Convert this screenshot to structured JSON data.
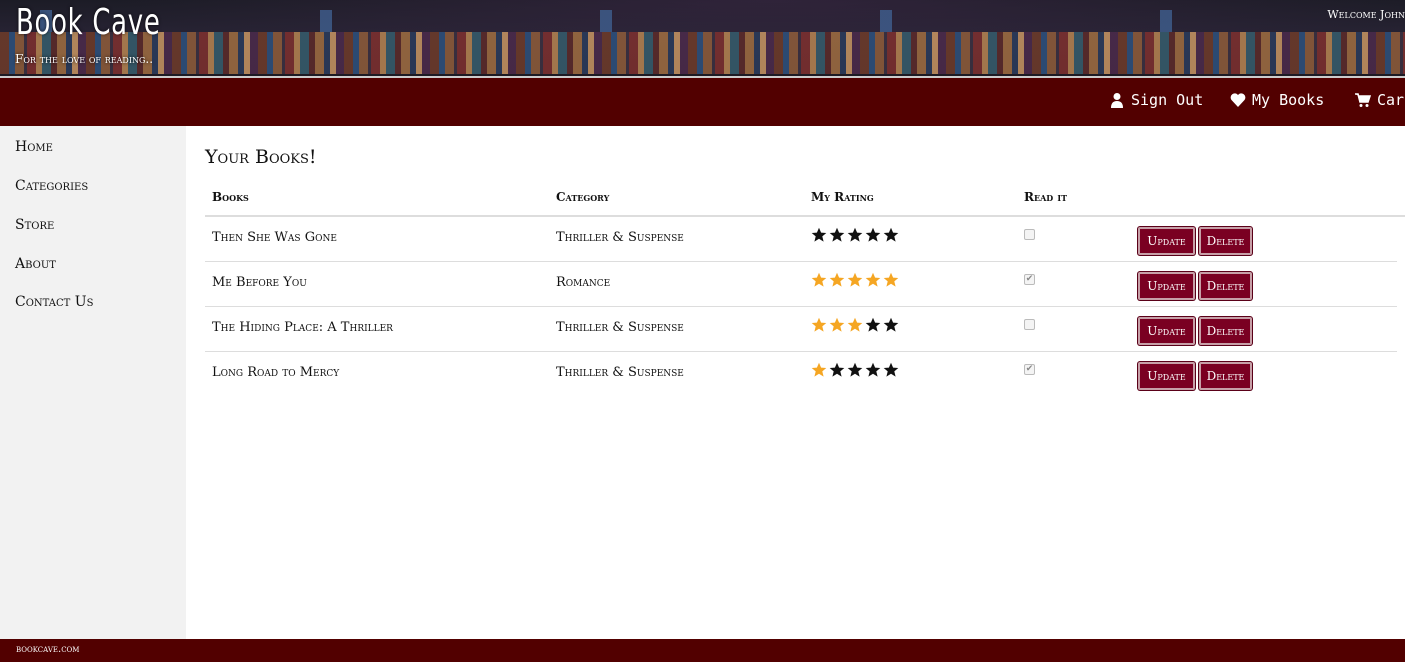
{
  "header": {
    "brand": "Book Cave",
    "tagline": "For the love of reading..",
    "welcome": "Welcome John"
  },
  "nav": {
    "items": [
      {
        "label": "Sign Out",
        "icon": "user-icon"
      },
      {
        "label": "My Books",
        "icon": "heart-icon"
      },
      {
        "label": "Cart",
        "icon": "cart-icon"
      }
    ]
  },
  "sidebar": {
    "items": [
      {
        "label": "Home"
      },
      {
        "label": "Categories"
      },
      {
        "label": "Store"
      },
      {
        "label": "About"
      },
      {
        "label": "Contact Us"
      }
    ]
  },
  "main": {
    "title": "Your Books!",
    "columns": [
      "Books",
      "Category",
      "My Rating",
      "Read it"
    ],
    "rows": [
      {
        "book": "Then She Was Gone",
        "category": "Thriller & Suspense",
        "rating": 0,
        "read": false
      },
      {
        "book": "Me Before You",
        "category": "Romance",
        "rating": 5,
        "read": true
      },
      {
        "book": "The Hiding Place: A Thriller",
        "category": "Thriller & Suspense",
        "rating": 3,
        "read": false
      },
      {
        "book": "Long Road to Mercy",
        "category": "Thriller & Suspense",
        "rating": 1,
        "read": true
      }
    ],
    "update_label": "Update",
    "delete_label": "Delete",
    "max_rating": 5
  },
  "footer": {
    "text": "bookcave.com"
  },
  "colors": {
    "navbar": "#520000",
    "button": "#7a0022",
    "star_filled": "#f5a623",
    "star_empty": "#111111",
    "sidebar": "#f2f2f2"
  }
}
